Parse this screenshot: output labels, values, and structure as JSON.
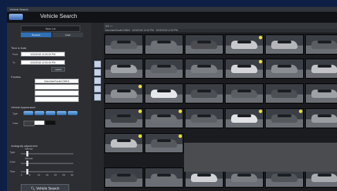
{
  "window": {
    "title": "Vehicle Search"
  },
  "app": {
    "title": "Vehicle Search",
    "camera_select": "New Lot"
  },
  "tabs": [
    {
      "label": "Search"
    },
    {
      "label": "Live"
    }
  ],
  "time_date": {
    "section": "Time & Date",
    "from_label": "From",
    "from_value": "3/23/2018 12:00:00 PM",
    "to_label": "To",
    "to_value": "3/23/2018 12:00:00 PM",
    "latest_button": "Latest"
  },
  "position": {
    "section": "Position",
    "item": "franchise/South/C6818"
  },
  "appearance": {
    "section": "Vehicle Appearance",
    "type_label": "Type",
    "color_label": "Color"
  },
  "ambiguity": {
    "section": "Ambiguity adjustment",
    "type_label": "Type",
    "color_label": "Color",
    "time_label": "Time",
    "type_value": "Narrow",
    "color_value": "Narrow",
    "ticks": [
      "0",
      "5",
      "10",
      "15",
      "20",
      "25",
      "30"
    ]
  },
  "search_button": "Vehicle Search",
  "results": {
    "toolbar": "1/1 ‹ ›",
    "header": "franchise/South/C6818 · 3/23/2018 12:00 PM · 3/23/2018 12:00 PM"
  },
  "colors": {
    "accent": "#2f6fb3",
    "badge": "#f0e030"
  },
  "thumbnails": [
    {
      "car": "#5a5d62",
      "badge": false
    },
    {
      "car": "#6e7176",
      "badge": false
    },
    {
      "car": "#4a4c50",
      "badge": false
    },
    {
      "car": "#c7c9cc",
      "badge": true
    },
    {
      "car": "#b4b6b9",
      "badge": false
    },
    {
      "car": "#5a5d62",
      "badge": false
    },
    {
      "car": "#9fa2a6",
      "badge": false
    },
    {
      "car": "#5f6267",
      "badge": false
    },
    {
      "car": "#7a7d82",
      "badge": false
    },
    {
      "car": "#d3d5d8",
      "badge": true
    },
    {
      "car": "#8a8d91",
      "badge": false
    },
    {
      "car": "#c1c3c6",
      "badge": false
    },
    {
      "car": "#8c8f93",
      "badge": true
    },
    {
      "car": "#e5e7ea",
      "badge": false
    },
    {
      "car": "#4c4f54",
      "badge": false
    },
    {
      "car": "#5a5d62",
      "badge": false
    },
    {
      "car": "#4c4f54",
      "badge": false
    },
    {
      "car": "#9ea1a5",
      "badge": false
    },
    {
      "car": "#3f4247",
      "badge": true
    },
    {
      "car": "#6e7176",
      "badge": true
    },
    {
      "car": "#5d6065",
      "badge": false
    },
    {
      "car": "#e0e2e5",
      "badge": true
    },
    {
      "car": "#55585d",
      "badge": true
    },
    {
      "car": "#9a9da1",
      "badge": false
    },
    {
      "car": "#bfc1c4",
      "badge": true
    },
    {
      "car": "#55585d",
      "badge": true
    },
    {
      "car": "#46494e",
      "badge": false
    },
    {
      "car": "#6c6f74",
      "badge": false
    },
    {
      "car": "#cfd1d4",
      "badge": false
    },
    {
      "car": "#7a7d82",
      "badge": false
    },
    {
      "car": "#505358",
      "badge": false
    },
    {
      "car": "#a8abaf",
      "badge": false
    }
  ]
}
